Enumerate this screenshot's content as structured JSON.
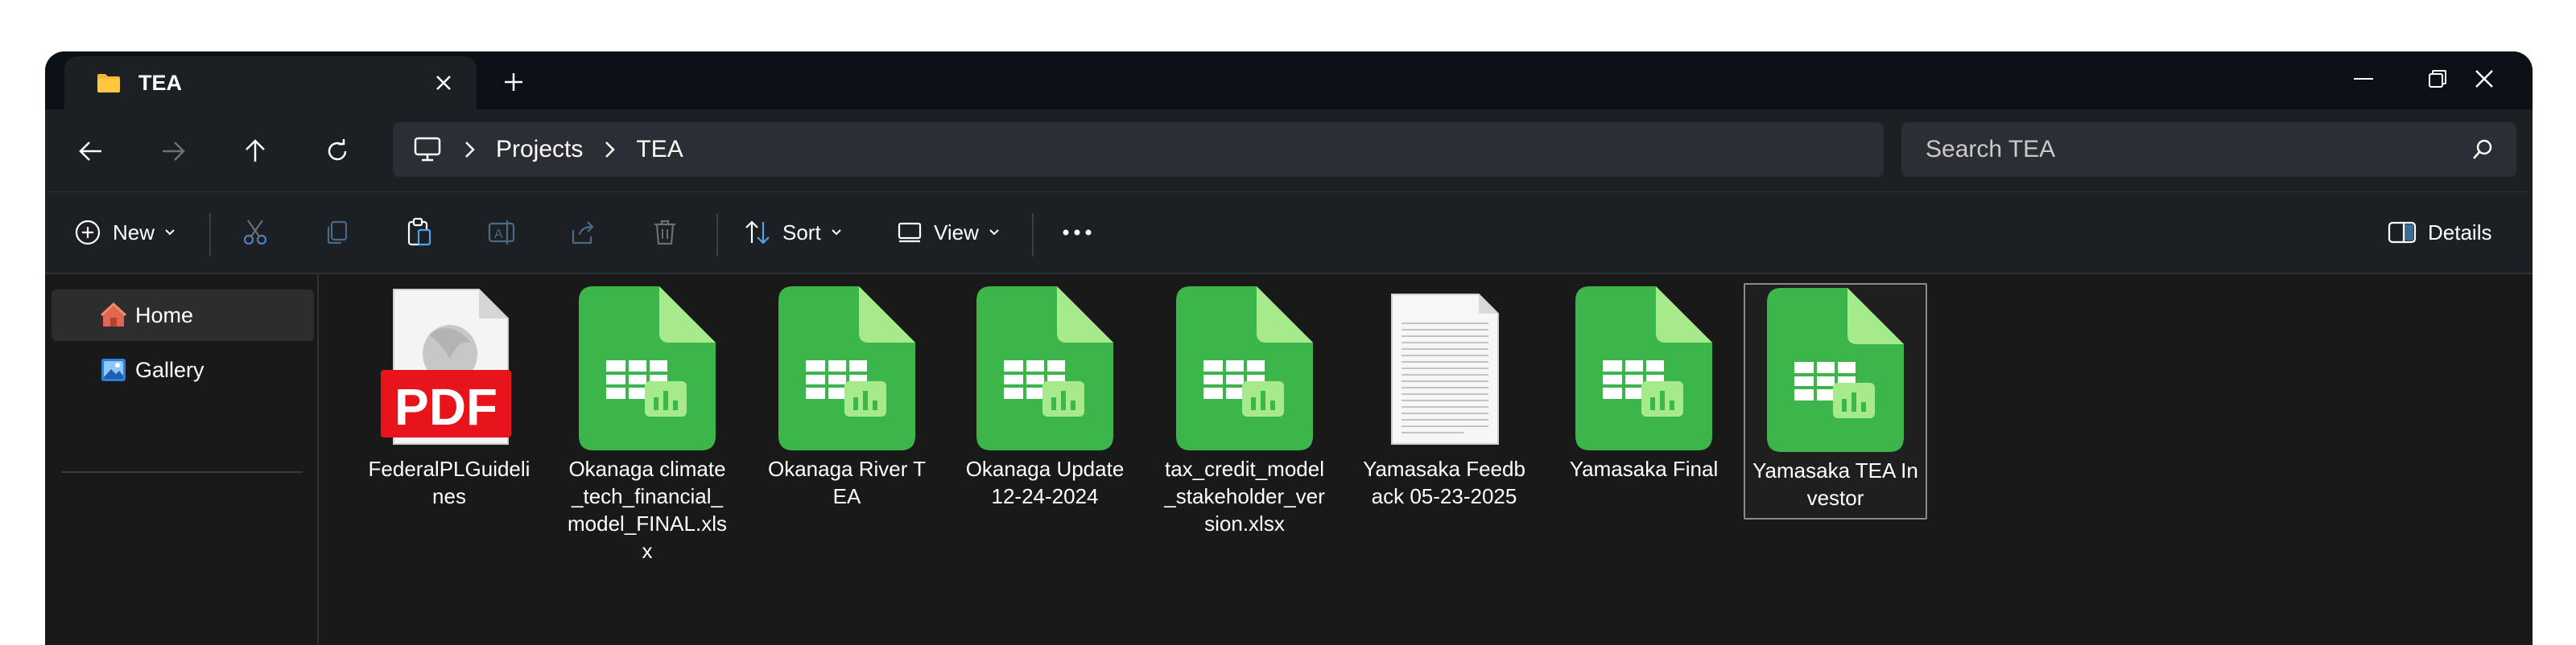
{
  "tab": {
    "title": "TEA",
    "folder_color": "#f4b731"
  },
  "navigation": {
    "breadcrumbs": [
      "Projects",
      "TEA"
    ],
    "search_placeholder": "Search TEA"
  },
  "toolbar": {
    "new_label": "New",
    "sort_label": "Sort",
    "view_label": "View",
    "details_label": "Details"
  },
  "sidebar": {
    "items": [
      {
        "label": "Home",
        "icon": "home-icon"
      },
      {
        "label": "Gallery",
        "icon": "gallery-icon"
      }
    ]
  },
  "files": [
    {
      "name": "FederalPLGuidelines",
      "type": "pdf",
      "pdf_badge": "PDF"
    },
    {
      "name": "Okanaga climate_tech_financial_model_FINAL.xlsx",
      "type": "spreadsheet"
    },
    {
      "name": "Okanaga River TEA",
      "type": "spreadsheet"
    },
    {
      "name": "Okanaga Update 12-24-2024",
      "type": "spreadsheet"
    },
    {
      "name": "tax_credit_model_stakeholder_version.xlsx",
      "type": "spreadsheet"
    },
    {
      "name": "Yamasaka Feedback 05-23-2025",
      "type": "document"
    },
    {
      "name": "Yamasaka Final",
      "type": "spreadsheet"
    },
    {
      "name": "Yamasaka TEA Investor",
      "type": "spreadsheet",
      "selected": true
    }
  ],
  "colors": {
    "spreadsheet_green": "#3cb54a",
    "pdf_red": "#e8141b",
    "accent_blue": "#60cdff"
  }
}
